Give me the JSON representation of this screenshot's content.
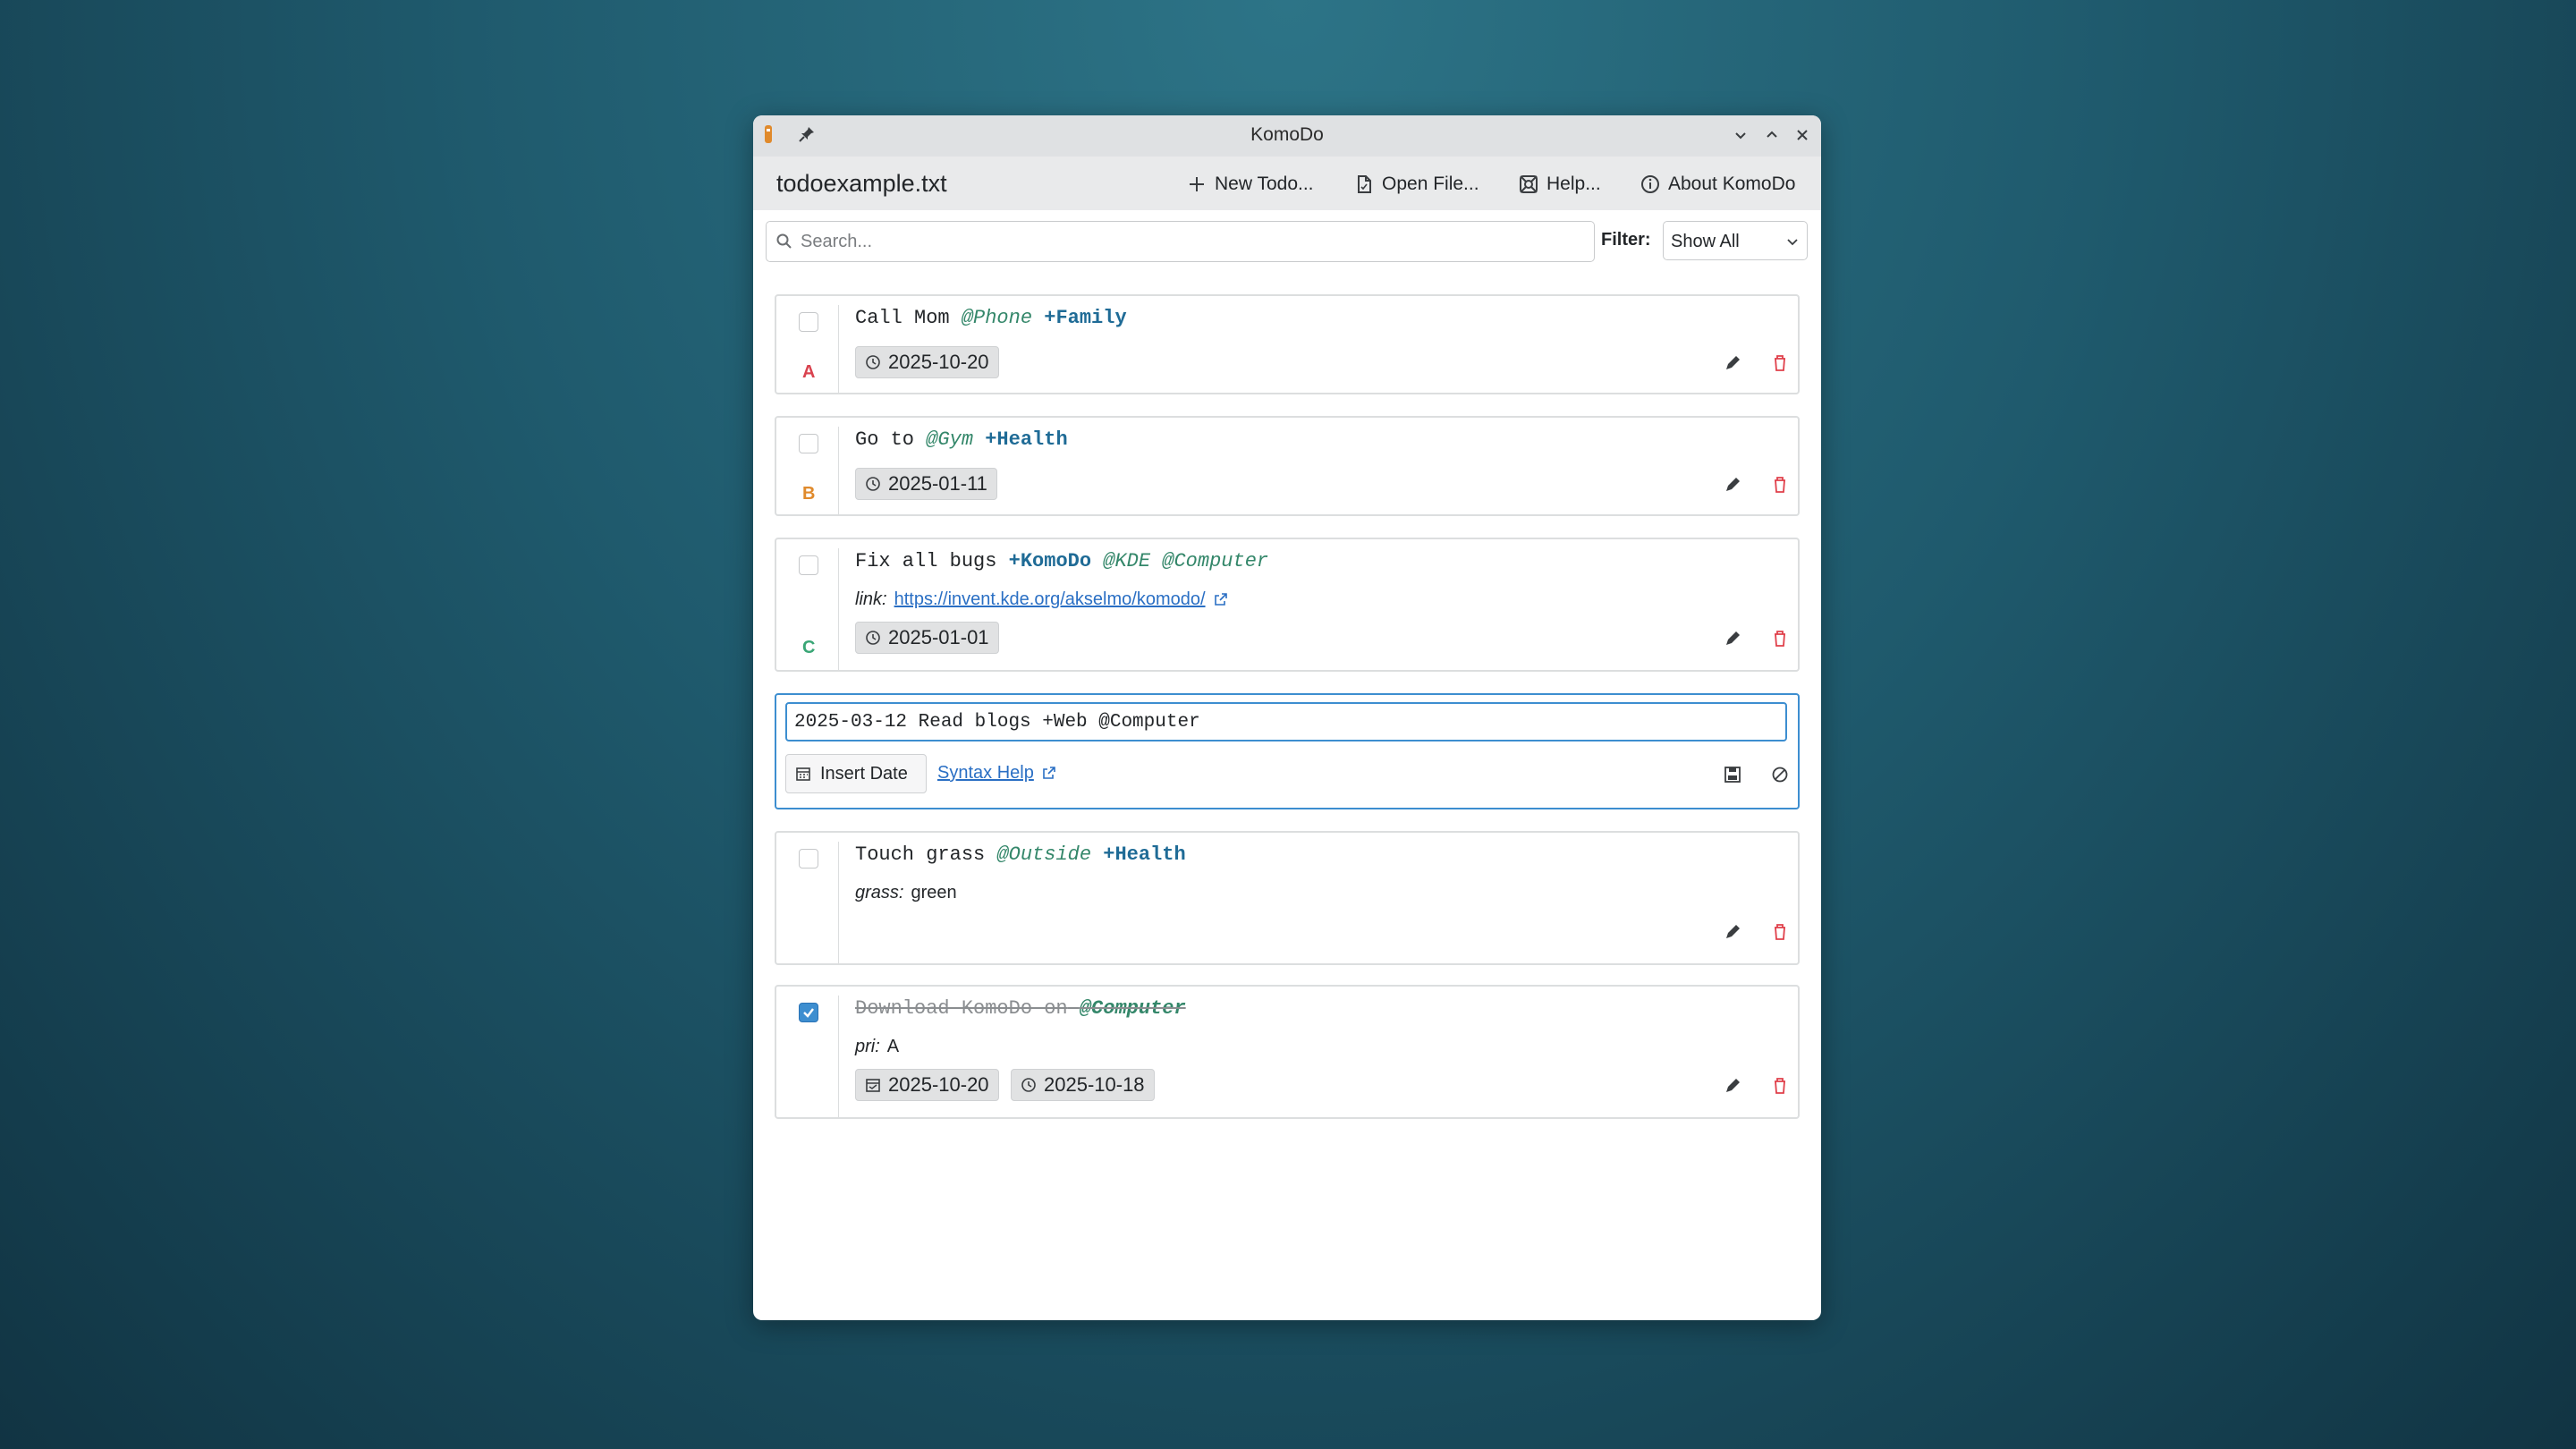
{
  "window": {
    "title": "KomoDo",
    "filename": "todoexample.txt"
  },
  "toolbar": {
    "new_todo": "New Todo...",
    "open_file": "Open File...",
    "help": "Help...",
    "about": "About KomoDo"
  },
  "search": {
    "placeholder": "Search...",
    "filter_label": "Filter:",
    "filter_value": "Show All"
  },
  "todos": [
    {
      "text": "Call Mom",
      "context": "@Phone",
      "project": "+Family",
      "priority": "A",
      "due": "2025-10-20",
      "done": false
    },
    {
      "text": "Go to",
      "context": "@Gym",
      "project": "+Health",
      "priority": "B",
      "due": "2025-01-11",
      "done": false
    },
    {
      "text": "Fix all bugs",
      "project": "+KomoDo",
      "context": "@KDE",
      "context2": "@Computer",
      "meta_key": "link:",
      "meta_value": "https://invent.kde.org/akselmo/komodo/",
      "priority": "C",
      "due": "2025-01-01",
      "done": false
    },
    {
      "text": "Touch grass",
      "context": "@Outside",
      "project": "+Health",
      "meta_key": "grass:",
      "meta_value": "green",
      "done": false
    },
    {
      "text": "Download KomoDo on",
      "context": "@Computer",
      "meta_key": "pri:",
      "meta_value": "A",
      "completed": "2025-10-20",
      "created": "2025-10-18",
      "done": true
    }
  ],
  "editor": {
    "value": "2025-03-12 Read blogs +Web @Computer",
    "insert_date": "Insert Date",
    "syntax_help": "Syntax Help"
  },
  "colors": {
    "accent": "#3d8ed0",
    "priority_a": "#d9434f",
    "priority_b": "#e08a2c",
    "priority_c": "#3aa676",
    "delete": "#e0404b",
    "context": "#34876a",
    "project": "#1f6b96"
  }
}
